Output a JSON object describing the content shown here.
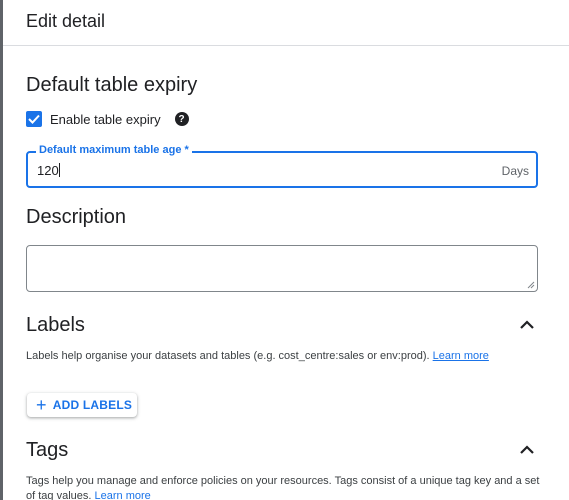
{
  "header": {
    "title": "Edit detail"
  },
  "expiry": {
    "title": "Default table expiry",
    "checkbox_label": "Enable table expiry",
    "checked": true,
    "help_icon": "question-circle-icon",
    "field_label": "Default maximum table age *",
    "field_value": "120",
    "field_suffix": "Days"
  },
  "description": {
    "title": "Description",
    "value": ""
  },
  "labels": {
    "title": "Labels",
    "help_text": "Labels help organise your datasets and tables (e.g. cost_centre:sales or env:prod).",
    "link": "Learn more",
    "add_button": "ADD LABELS",
    "add_icon": "plus-icon",
    "collapse_icon": "chevron-up-icon"
  },
  "tags": {
    "title": "Tags",
    "help_text": "Tags help you manage and enforce policies on your resources. Tags consist of a unique tag key and a set of tag values.",
    "link": "Learn more",
    "collapse_icon": "chevron-up-icon"
  },
  "colors": {
    "accent": "#1a73e8",
    "text": "#202124",
    "border": "#dadce0"
  }
}
